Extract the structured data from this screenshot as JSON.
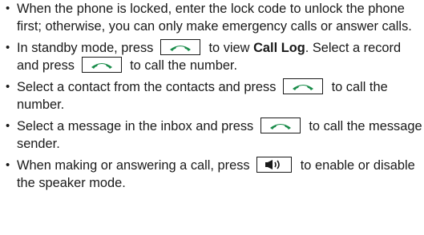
{
  "items": [
    {
      "text": "When the phone is locked, enter the lock code to unlock the phone first; otherwise, you can only make emergency calls or answer calls."
    },
    {
      "pre": "In standby mode, press",
      "mid1": "to view",
      "bold": "Call Log",
      "mid2": ". Select a record and press",
      "post": "to call the number."
    },
    {
      "pre": "Select a contact from the contacts and press",
      "post": "to call the number."
    },
    {
      "pre": "Select a message in the inbox and press",
      "post": "to call the message sender."
    },
    {
      "pre": "When making or answering a call, press",
      "post": "to enable or disable the speaker mode."
    }
  ],
  "icons": {
    "call_key": "call-handset-icon",
    "speaker_key": "speaker-icon"
  },
  "colors": {
    "call_key_green": "#1a8c4a"
  }
}
